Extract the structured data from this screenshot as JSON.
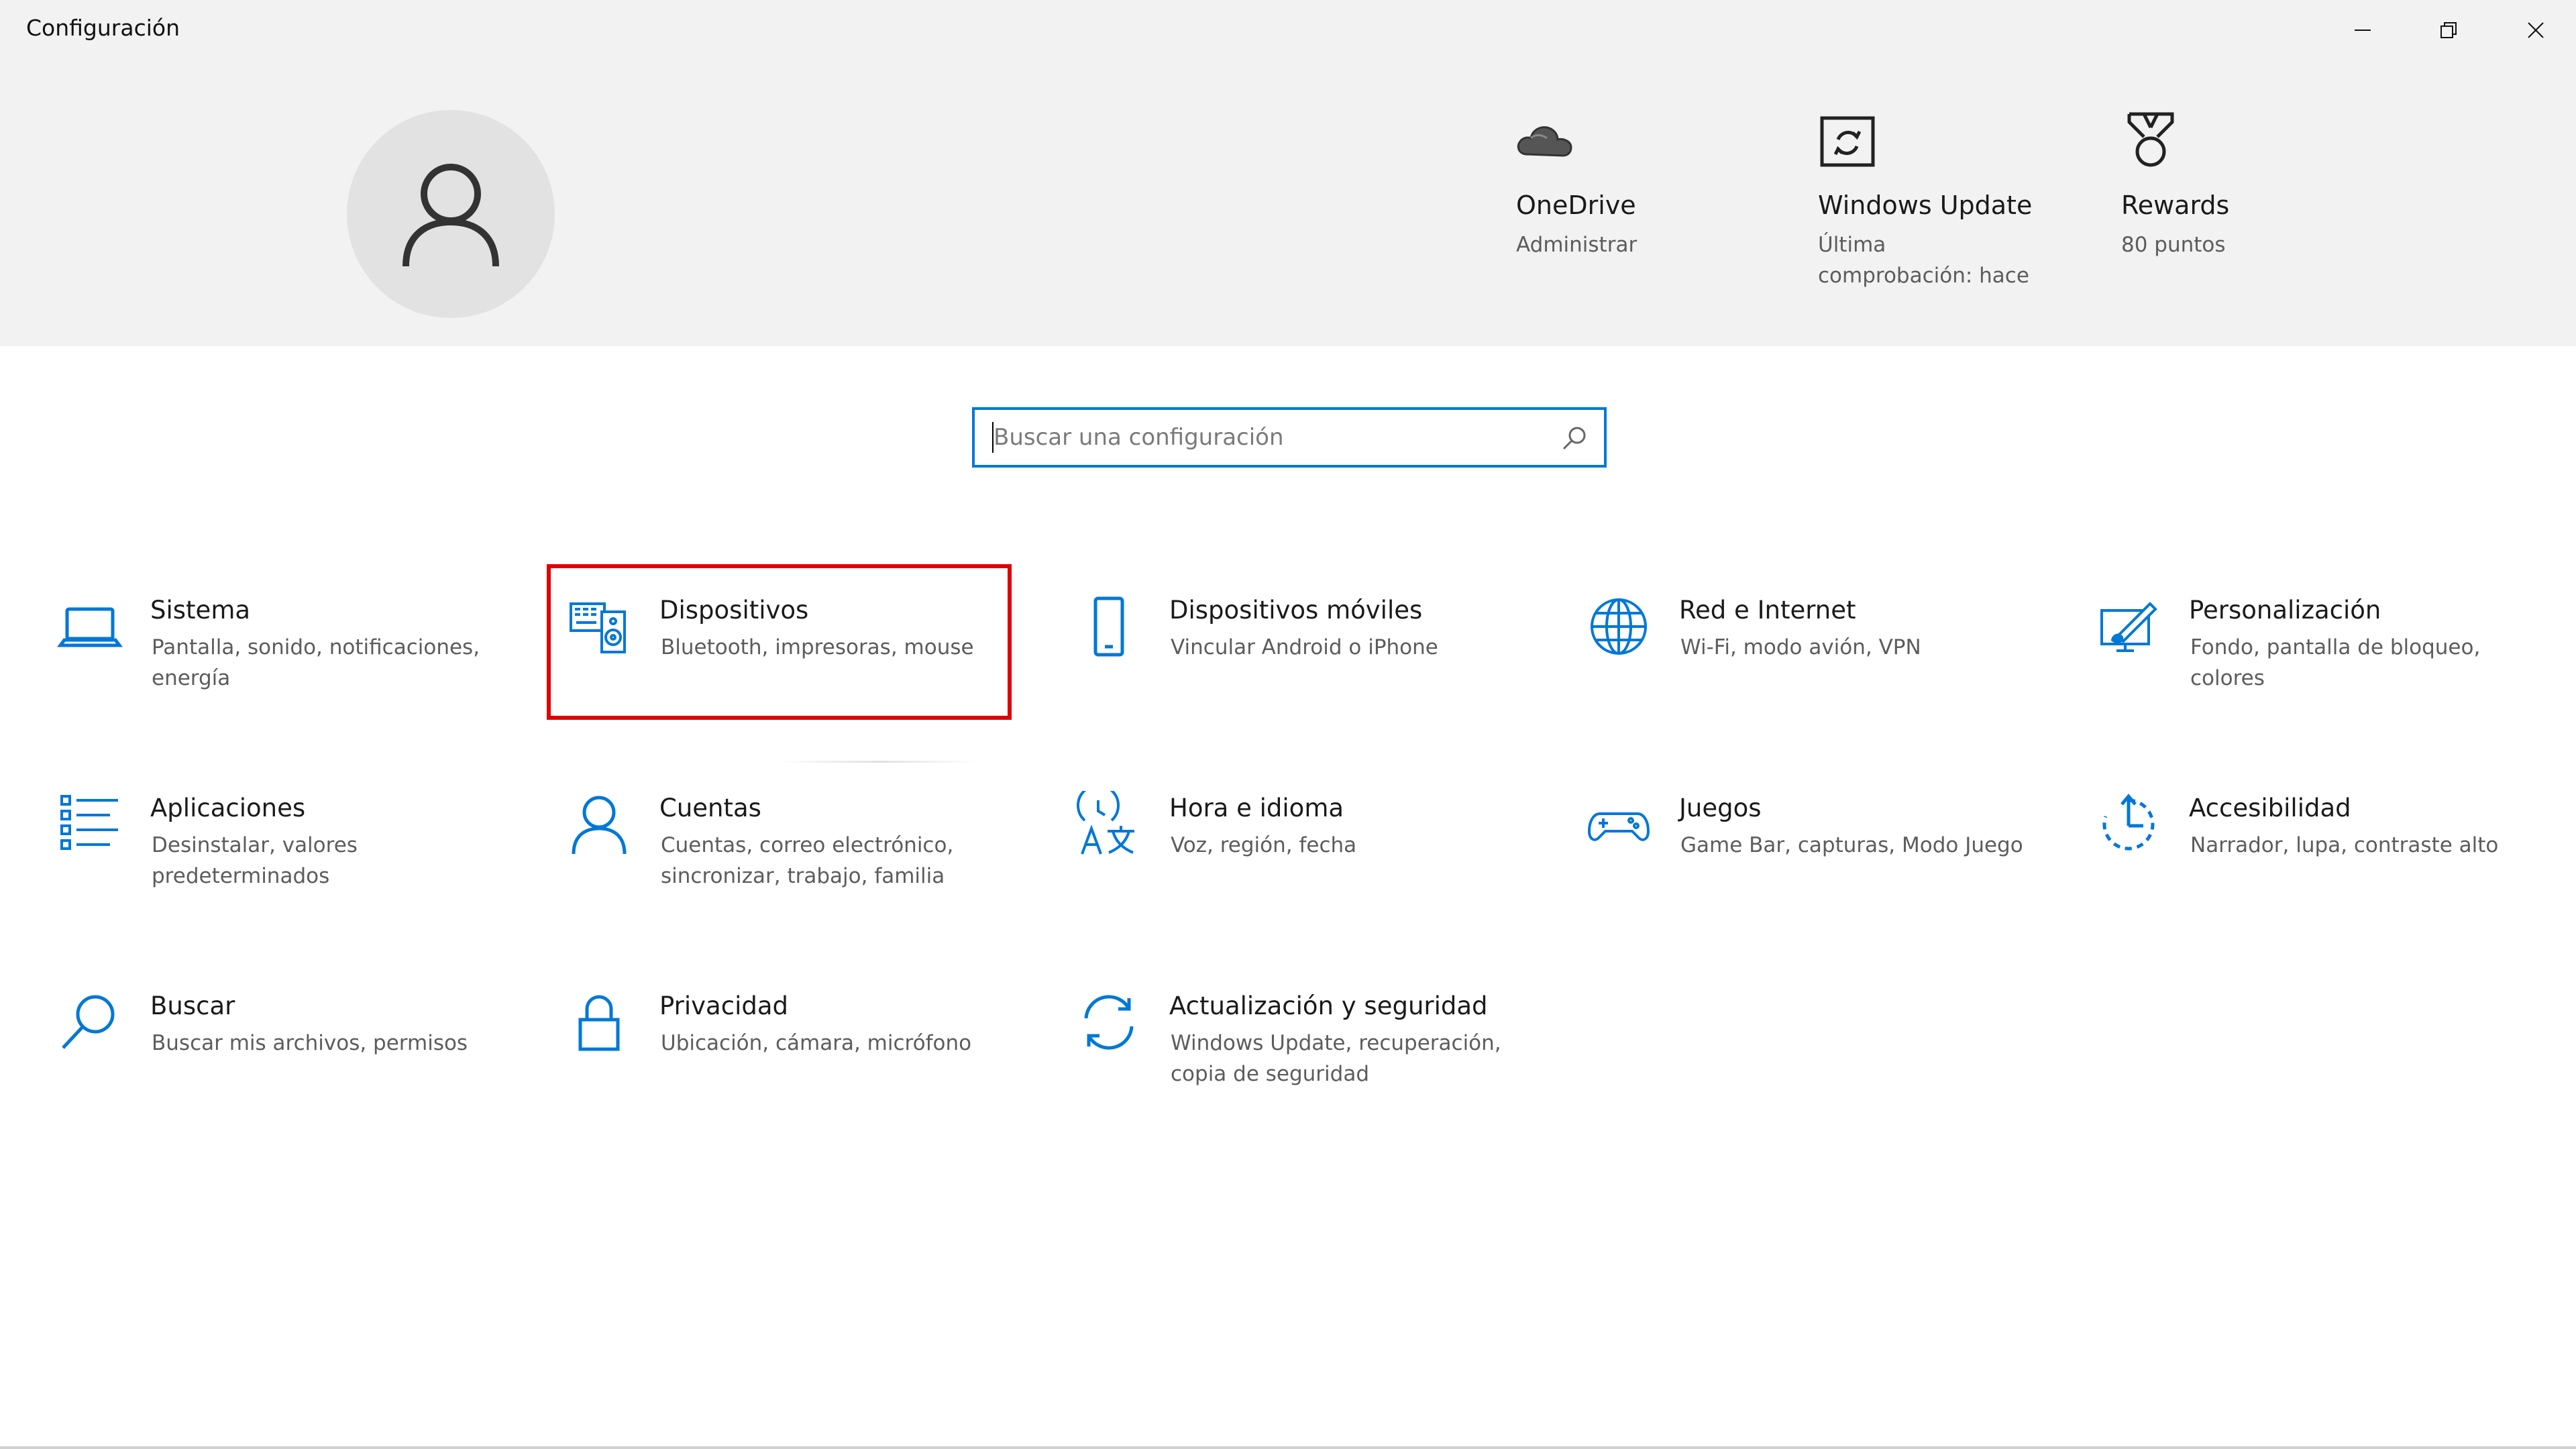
{
  "window": {
    "title": "Configuración",
    "controls": [
      "minimize-icon",
      "restore-icon",
      "close-icon"
    ]
  },
  "header": {
    "avatar_icon": "person-icon",
    "quick_links": [
      {
        "icon": "cloud-icon",
        "title": "OneDrive",
        "subtitle": "Administrar"
      },
      {
        "icon": "windows-update-icon",
        "title": "Windows Update",
        "subtitle": "Última comprobación: hace"
      },
      {
        "icon": "medal-icon",
        "title": "Rewards",
        "subtitle": "80 puntos"
      }
    ]
  },
  "search": {
    "placeholder": "Buscar una configuración",
    "value": ""
  },
  "tiles": [
    {
      "icon": "laptop-icon",
      "title": "Sistema",
      "desc": "Pantalla, sonido, notificaciones, energía"
    },
    {
      "icon": "devices-icon",
      "title": "Dispositivos",
      "desc": "Bluetooth, impresoras, mouse",
      "highlighted": true
    },
    {
      "icon": "phone-icon",
      "title": "Dispositivos móviles",
      "desc": "Vincular Android o iPhone"
    },
    {
      "icon": "globe-icon",
      "title": "Red e Internet",
      "desc": "Wi-Fi, modo avión, VPN"
    },
    {
      "icon": "paintbrush-icon",
      "title": "Personalización",
      "desc": "Fondo, pantalla de bloqueo, colores"
    },
    {
      "icon": "apps-list-icon",
      "title": "Aplicaciones",
      "desc": "Desinstalar, valores predeterminados"
    },
    {
      "icon": "person-icon",
      "title": "Cuentas",
      "desc": "Cuentas, correo electrónico, sincronizar, trabajo, familia"
    },
    {
      "icon": "time-language-icon",
      "title": "Hora e idioma",
      "desc": "Voz, región, fecha"
    },
    {
      "icon": "gamepad-icon",
      "title": "Juegos",
      "desc": "Game Bar, capturas, Modo Juego"
    },
    {
      "icon": "accessibility-icon",
      "title": "Accesibilidad",
      "desc": "Narrador, lupa, contraste alto"
    },
    {
      "icon": "search-icon",
      "title": "Buscar",
      "desc": "Buscar mis archivos, permisos"
    },
    {
      "icon": "lock-icon",
      "title": "Privacidad",
      "desc": "Ubicación, cámara, micrófono"
    },
    {
      "icon": "sync-icon",
      "title": "Actualización y seguridad",
      "desc": "Windows Update, recuperación, copia de seguridad"
    }
  ],
  "colors": {
    "accent": "#0078d7",
    "highlight": "#e00000",
    "header_bg": "#f2f2f2"
  }
}
